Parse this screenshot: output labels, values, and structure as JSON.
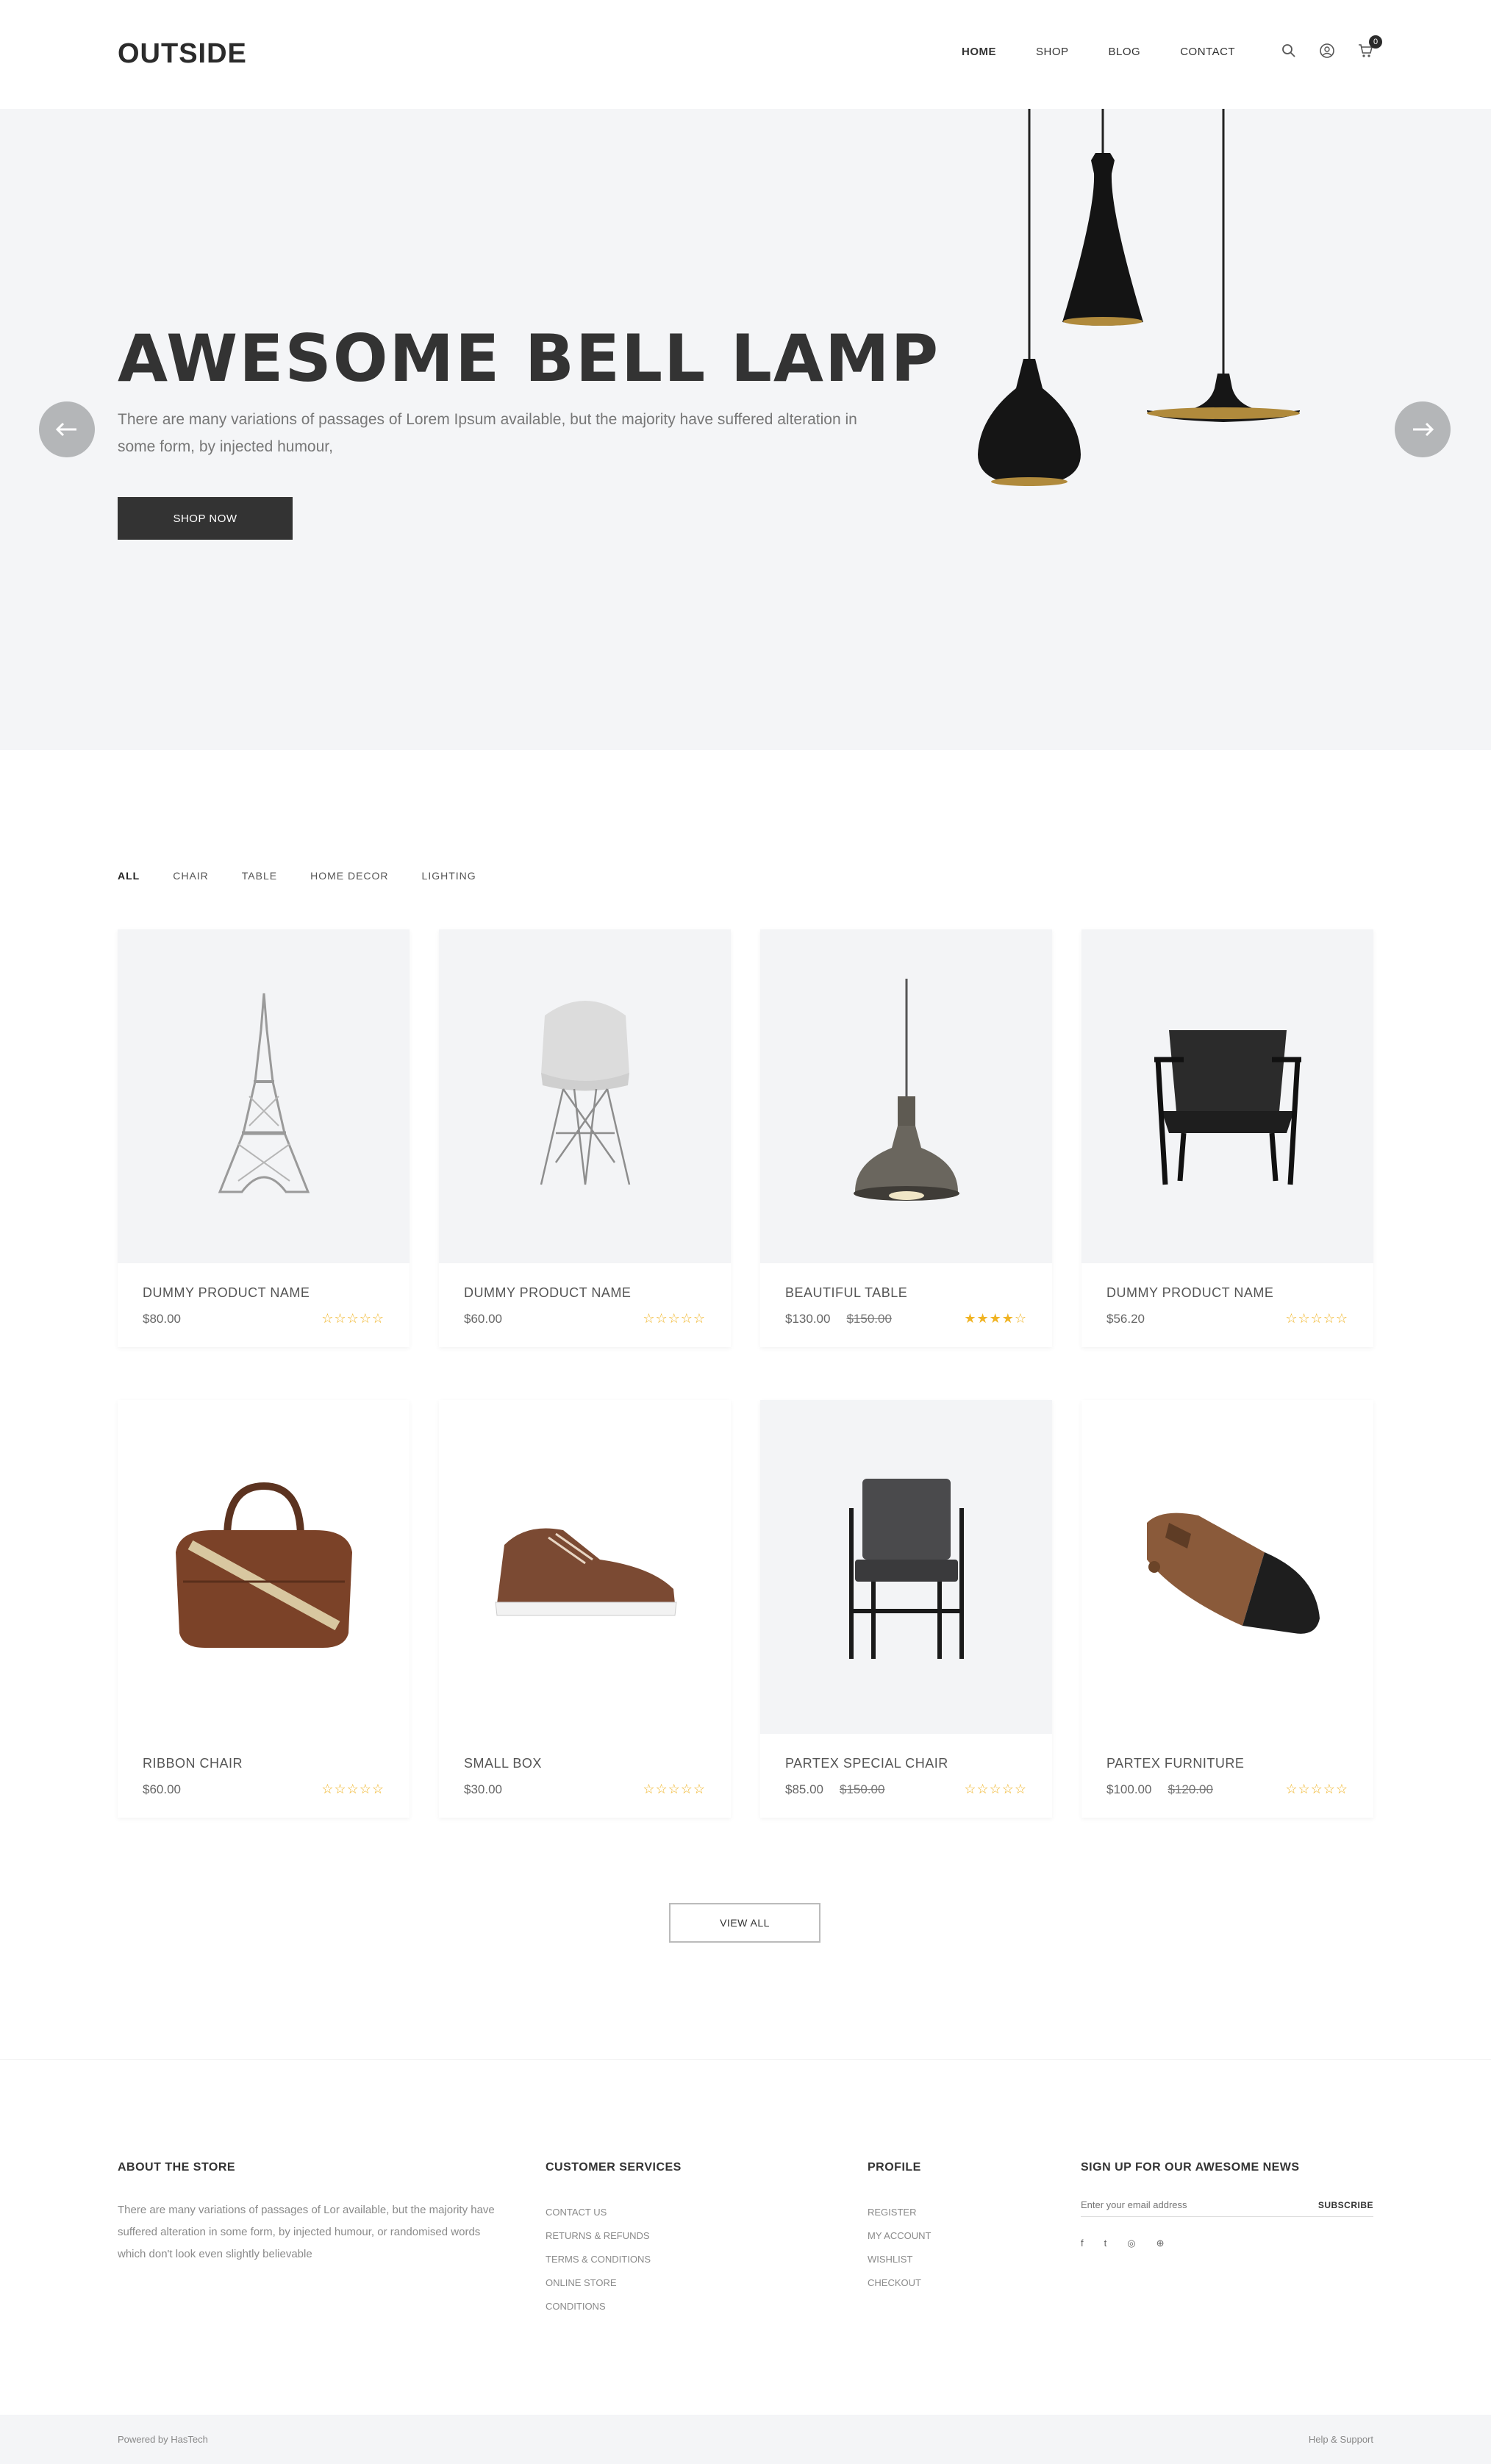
{
  "header": {
    "logo": "OUTSIDE",
    "nav": [
      "HOME",
      "SHOP",
      "BLOG",
      "CONTACT"
    ],
    "cart_count": "0",
    "icons": [
      "search-icon",
      "user-icon",
      "cart-icon"
    ]
  },
  "hero": {
    "title": "AWESOME BELL LAMP",
    "description": "There are many variations of passages of Lorem Ipsum available, but the majority have suffered alteration in some form, by injected humour,",
    "button": "SHOP NOW",
    "prev_icon": "arrow-left-icon",
    "next_icon": "arrow-right-icon"
  },
  "filters": [
    "ALL",
    "CHAIR",
    "TABLE",
    "HOME DECOR",
    "LIGHTING"
  ],
  "products": [
    {
      "name": "DUMMY PRODUCT NAME",
      "price": "$80.00",
      "old_price": "",
      "rating": 0,
      "image": "eiffel-tower-model"
    },
    {
      "name": "DUMMY PRODUCT NAME",
      "price": "$60.00",
      "old_price": "",
      "rating": 0,
      "image": "white-chair"
    },
    {
      "name": "BEAUTIFUL TABLE",
      "price": "$130.00",
      "old_price": "$150.00",
      "rating": 4,
      "image": "pendant-lamp"
    },
    {
      "name": "DUMMY PRODUCT NAME",
      "price": "$56.20",
      "old_price": "",
      "rating": 0,
      "image": "black-armchair"
    },
    {
      "name": "RIBBON CHAIR",
      "price": "$60.00",
      "old_price": "",
      "rating": 0,
      "image": "leather-bag"
    },
    {
      "name": "SMALL BOX",
      "price": "$30.00",
      "old_price": "",
      "rating": 0,
      "image": "leather-sneaker"
    },
    {
      "name": "PARTEX SPECIAL CHAIR",
      "price": "$85.00",
      "old_price": "$150.00",
      "rating": 0,
      "image": "grey-chair"
    },
    {
      "name": "PARTEX FURNITURE",
      "price": "$100.00",
      "old_price": "$120.00",
      "rating": 0,
      "image": "wooden-doorstop"
    }
  ],
  "view_all": "VIEW ALL",
  "footer": {
    "about_title": "ABOUT THE STORE",
    "about_text": "There are many variations of passages of Lor available, but the majority have suffered alteration in some form, by injected humour, or randomised words which don't look even slightly believable",
    "services_title": "CUSTOMER SERVICES",
    "services": [
      "CONTACT US",
      "RETURNS & REFUNDS",
      "TERMS & CONDITIONS",
      "ONLINE STORE",
      "CONDITIONS"
    ],
    "profile_title": "PROFILE",
    "profile": [
      "REGISTER",
      "MY ACCOUNT",
      "WISHLIST",
      "CHECKOUT"
    ],
    "news_title": "SIGN UP FOR OUR AWESOME NEWS",
    "news_placeholder": "Enter your email address",
    "subscribe": "SUBSCRIBE",
    "socials": [
      "f",
      "t",
      "i",
      "p"
    ]
  },
  "bottom": {
    "left": "Powered by HasTech",
    "right": "Help & Support"
  }
}
